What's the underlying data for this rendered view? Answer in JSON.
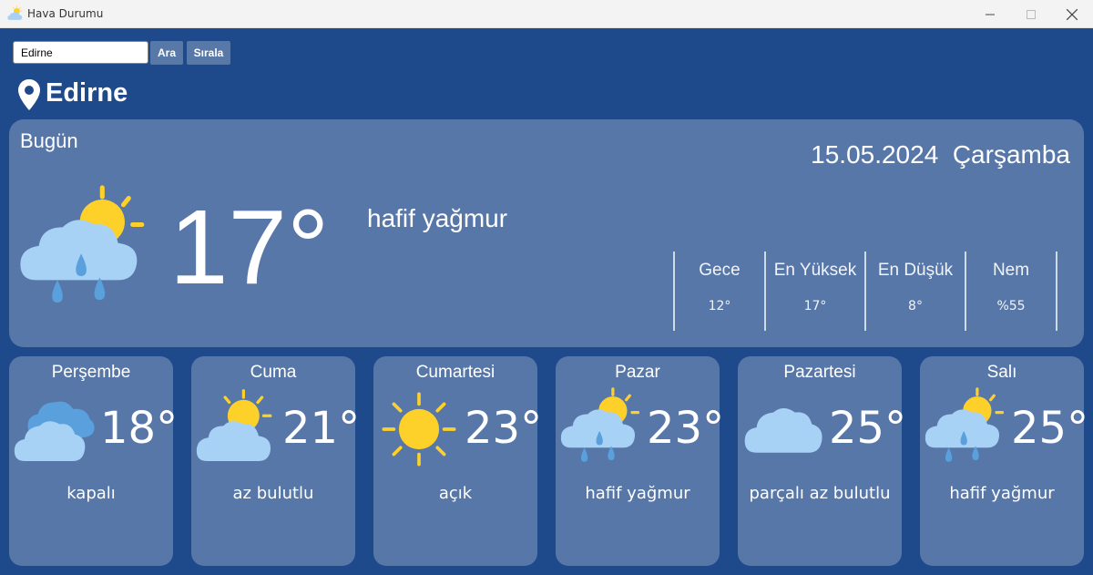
{
  "window": {
    "title": "Hava Durumu",
    "app_icon": "partly-cloudy-icon"
  },
  "search": {
    "value": "Edirne",
    "search_label": "Ara",
    "sort_label": "Sırala"
  },
  "location": {
    "city": "Edirne",
    "icon": "location-pin-icon"
  },
  "today": {
    "label": "Bugün",
    "date": "15.05.2024  Çarşamba",
    "temperature": "17°",
    "description": "hafif yağmur",
    "icon": "rain-sun-cloud-icon",
    "stats": [
      {
        "label": "Gece",
        "value": "12°"
      },
      {
        "label": "En Yüksek",
        "value": "17°"
      },
      {
        "label": "En Düşük",
        "value": "8°"
      },
      {
        "label": "Nem",
        "value": "%55"
      }
    ]
  },
  "forecast": [
    {
      "day": "Perşembe",
      "temp": "18°",
      "desc": "kapalı",
      "icon": "overcast-clouds-icon"
    },
    {
      "day": "Cuma",
      "temp": "21°",
      "desc": "az bulutlu",
      "icon": "sun-behind-cloud-icon"
    },
    {
      "day": "Cumartesi",
      "temp": "23°",
      "desc": "açık",
      "icon": "sun-icon"
    },
    {
      "day": "Pazar",
      "temp": "23°",
      "desc": "hafif yağmur",
      "icon": "rain-sun-cloud-icon"
    },
    {
      "day": "Pazartesi",
      "temp": "25°",
      "desc": "parçalı az bulutlu",
      "icon": "cloud-icon"
    },
    {
      "day": "Salı",
      "temp": "25°",
      "desc": "hafif yağmur",
      "icon": "rain-sun-cloud-icon"
    }
  ],
  "colors": {
    "background": "#1e4a8c",
    "panel": "#5777a8",
    "sun": "#fdd12a",
    "cloud": "#a8d2f5",
    "rain": "#5aa0dc"
  }
}
